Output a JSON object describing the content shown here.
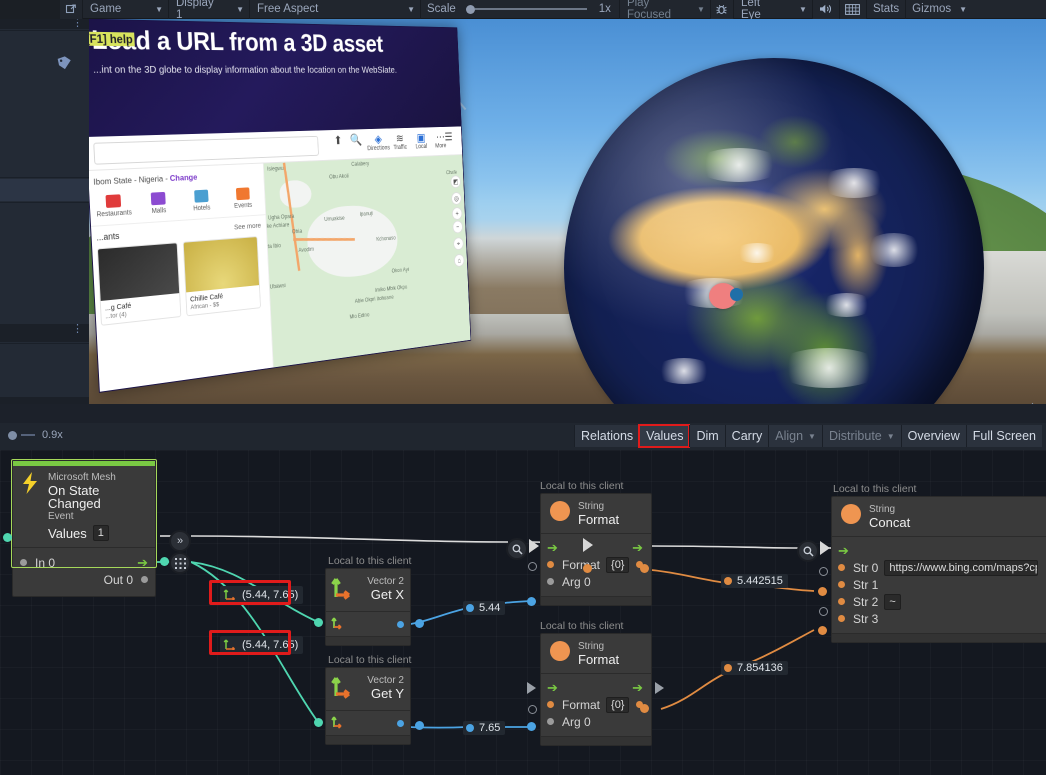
{
  "toolbar": {
    "maximize_icon": "maximize-icon",
    "view_mode": "Game",
    "display": "Display 1",
    "aspect": "Free Aspect",
    "scale_label": "Scale",
    "scale_value": "1x",
    "play_mode": "Play Focused",
    "bug_icon": "bug-icon",
    "eye_mode": "Left Eye",
    "mute_icon": "speaker-icon",
    "grid_icon": "grid-icon",
    "stats": "Stats",
    "gizmos": "Gizmos"
  },
  "gameview": {
    "slate": {
      "title": "Load a URL from a 3D asset",
      "subtitle": "...int on the 3D globe to display information about the location on the WebSlate.",
      "f1_badge": "[F1] help",
      "breadcrumb_prefix": "Ibom State - Nigeria -",
      "breadcrumb_action": "Change",
      "categories": [
        {
          "label": "Restaurants",
          "color": "#e03b3b"
        },
        {
          "label": "Malls",
          "color": "#8c4bd1"
        },
        {
          "label": "Hotels",
          "color": "#4b9fd1"
        },
        {
          "label": "Events",
          "color": "#f07830"
        }
      ],
      "section_title": "...ants",
      "see_more": "See more",
      "cards": [
        {
          "name": "...g Café",
          "meta": "...tor (4)"
        },
        {
          "name": "Chillie Café",
          "meta": "African - $$"
        }
      ],
      "map_labels": [
        "Isiegwu",
        "Calabery",
        "Obu Akoli",
        "Chafe",
        "Ugha Opara",
        "ke Achiare",
        "Umuakise",
        "Ohia",
        "ta Ibio",
        "Avodim",
        "Ipanuji",
        "Kchonuso",
        "Ubawsi",
        "Okon Ayi",
        "Imiko Mbik Okpu",
        "Abie Okpri Itohuane",
        "Mio Edino"
      ]
    }
  },
  "graph_toolbar": {
    "zoom_level": "0.9x",
    "tabs": [
      {
        "label": "Relations",
        "state": "normal"
      },
      {
        "label": "Values",
        "state": "selected"
      },
      {
        "label": "Dim",
        "state": "normal"
      },
      {
        "label": "Carry",
        "state": "normal"
      },
      {
        "label": "Align",
        "state": "disabled",
        "caret": true
      },
      {
        "label": "Distribute",
        "state": "disabled",
        "caret": true
      },
      {
        "label": "Overview",
        "state": "normal"
      },
      {
        "label": "Full Screen",
        "state": "normal"
      }
    ]
  },
  "graph": {
    "nodes": [
      {
        "id": "event",
        "scope": "",
        "namespace": "Microsoft Mesh",
        "title": "On State Changed",
        "kind": "Event",
        "icon": "lightning-icon",
        "prop_label": "Values",
        "prop_value": "1",
        "ports_in": "In 0",
        "ports_out": "Out 0"
      },
      {
        "id": "get-x",
        "scope": "Local to this client",
        "namespace": "Vector 2",
        "title": "Get X",
        "icon": "vector2-icon"
      },
      {
        "id": "get-y",
        "scope": "Local to this client",
        "namespace": "Vector 2",
        "title": "Get Y",
        "icon": "vector2-icon"
      },
      {
        "id": "format-1",
        "scope": "Local to this client",
        "namespace": "String",
        "title": "Format",
        "icon": "string-icon",
        "rows": [
          {
            "label": "Format",
            "field": "{0}",
            "dot": "orange"
          },
          {
            "label": "Arg 0",
            "dot": "gray"
          }
        ]
      },
      {
        "id": "format-2",
        "scope": "Local to this client",
        "namespace": "String",
        "title": "Format",
        "icon": "string-icon",
        "rows": [
          {
            "label": "Format",
            "field": "{0}",
            "dot": "orange"
          },
          {
            "label": "Arg 0",
            "dot": "gray"
          }
        ]
      },
      {
        "id": "concat",
        "scope": "Local to this client",
        "namespace": "String",
        "title": "Concat",
        "icon": "string-icon",
        "rows": [
          {
            "label": "Str 0",
            "field": "https://www.bing.com/maps?cp",
            "dot": "orange"
          },
          {
            "label": "Str 1",
            "dot": "orange"
          },
          {
            "label": "Str 2",
            "field": "~",
            "dot": "orange"
          },
          {
            "label": "Str 3",
            "dot": "orange"
          }
        ]
      }
    ],
    "value_chips": [
      {
        "id": "vec-a",
        "text": "(5.44, 7.65)",
        "type": "vector2",
        "boxed": true
      },
      {
        "id": "vec-b",
        "text": "(5.44, 7.65)",
        "type": "vector2",
        "boxed": true
      },
      {
        "id": "x-val",
        "text": "5.44",
        "type": "float"
      },
      {
        "id": "y-val",
        "text": "7.65",
        "type": "float"
      },
      {
        "id": "str-1",
        "text": "5.442515",
        "type": "string"
      },
      {
        "id": "str-2",
        "text": "7.854136",
        "type": "string"
      }
    ],
    "inline_buttons": [
      {
        "id": "collapse",
        "icon": "double-chevron-icon"
      },
      {
        "id": "reroute",
        "icon": "grid-dots-icon"
      },
      {
        "id": "inspect-1",
        "icon": "magnifier-icon"
      },
      {
        "id": "inspect-2",
        "icon": "magnifier-icon"
      }
    ]
  }
}
